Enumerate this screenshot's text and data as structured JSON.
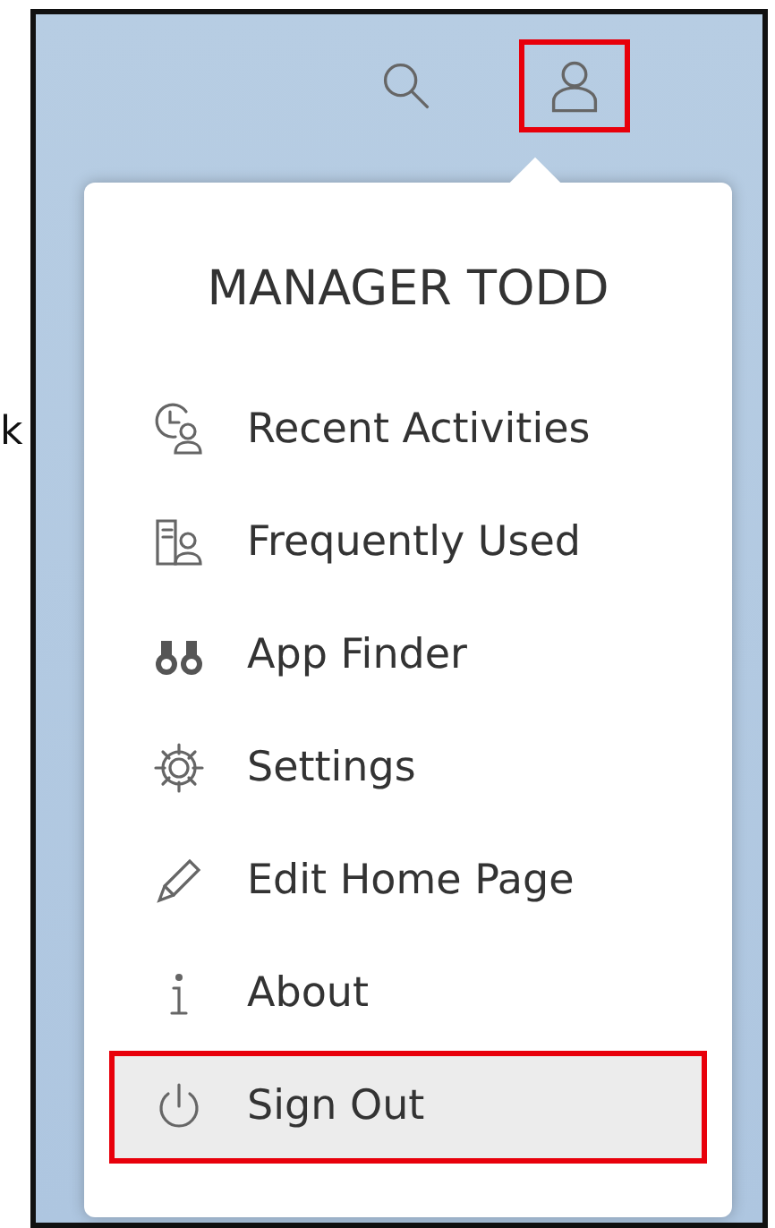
{
  "margin_text": "k",
  "header": {
    "buttons": [
      {
        "kind": "search",
        "highlighted": false
      },
      {
        "kind": "user",
        "highlighted": true
      }
    ]
  },
  "menu": {
    "title": "MANAGER TODD",
    "items": [
      {
        "kind": "recent",
        "label": "Recent Activities",
        "selected": false,
        "highlighted": false
      },
      {
        "kind": "frequent",
        "label": "Frequently Used",
        "selected": false,
        "highlighted": false
      },
      {
        "kind": "finder",
        "label": "App Finder",
        "selected": false,
        "highlighted": false
      },
      {
        "kind": "settings",
        "label": "Settings",
        "selected": false,
        "highlighted": false
      },
      {
        "kind": "edit",
        "label": "Edit Home Page",
        "selected": false,
        "highlighted": false
      },
      {
        "kind": "about",
        "label": "About",
        "selected": false,
        "highlighted": false
      },
      {
        "kind": "signout",
        "label": "Sign Out",
        "selected": true,
        "highlighted": true
      }
    ]
  }
}
